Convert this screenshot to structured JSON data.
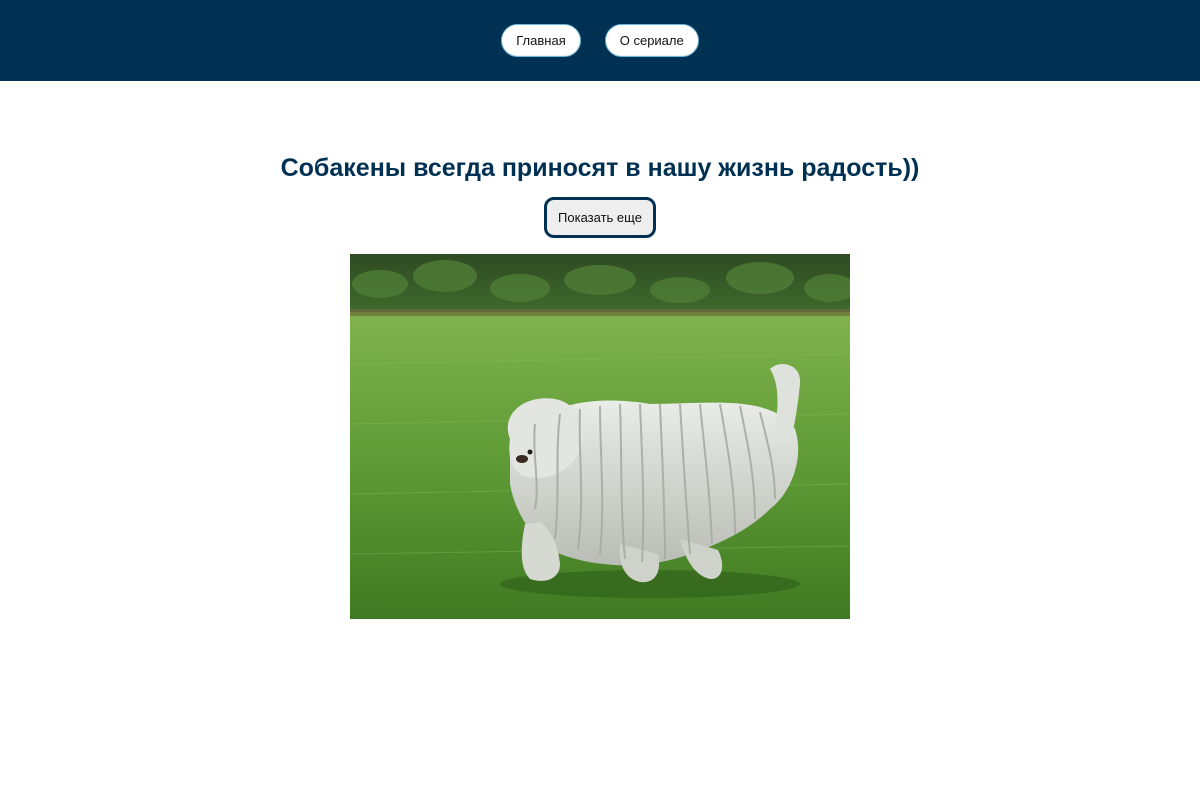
{
  "nav": {
    "items": [
      {
        "label": "Главная"
      },
      {
        "label": "О сериале"
      }
    ]
  },
  "main": {
    "headline": "Собакены всегда приносят в нашу жизнь радость))",
    "show_more_label": "Показать еще",
    "photo": {
      "subject": "komondor-dog-running-on-grass"
    }
  },
  "colors": {
    "header_bg": "#003153",
    "headline": "#003153",
    "button_border": "#003153",
    "nav_button_border": "#6fb7d6"
  }
}
